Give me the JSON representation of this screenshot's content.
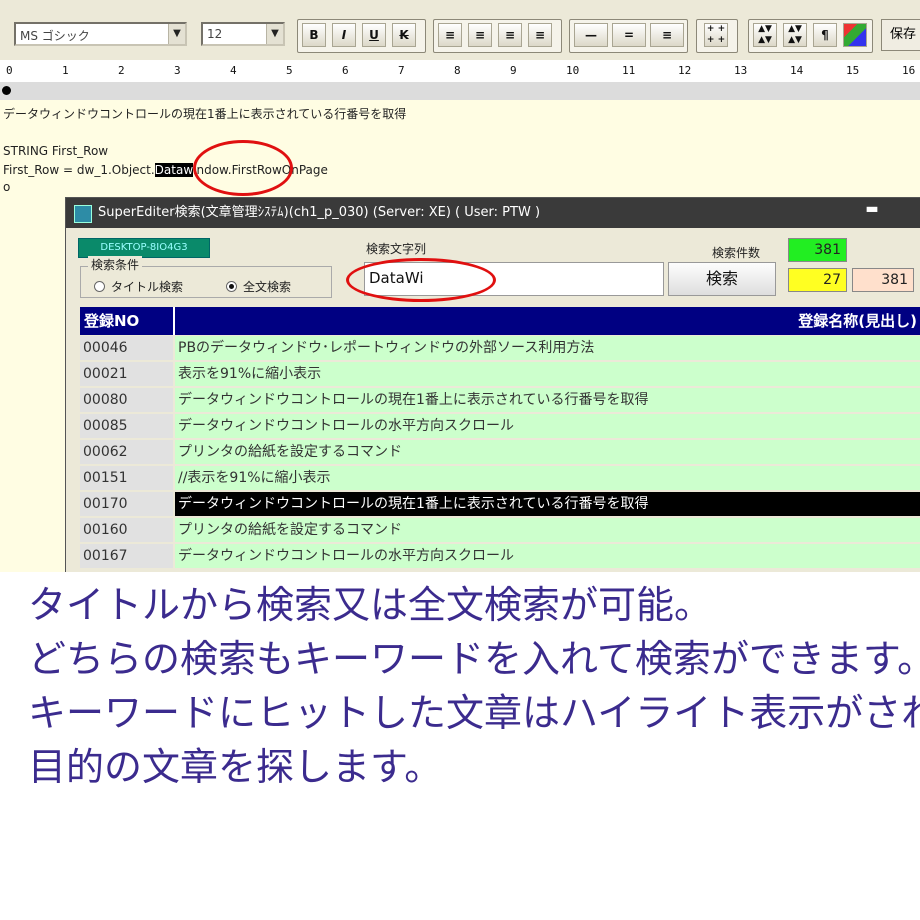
{
  "toolbar": {
    "font_value": "MS ゴシック",
    "size_value": "12",
    "bold": "B",
    "italic": "I",
    "underline": "U",
    "strike": "K",
    "pilcrow": "¶",
    "save_label": "保存"
  },
  "ruler": [
    "0",
    "1",
    "2",
    "3",
    "4",
    "5",
    "6",
    "7",
    "8",
    "9",
    "10",
    "11",
    "12",
    "13",
    "14",
    "15",
    "16"
  ],
  "editor": {
    "line1": "データウィンドウコントロールの現在1番上に表示されている行番号を取得",
    "line2": "STRING First_Row",
    "line3_pre": "First_Row = dw_1.Object.",
    "line3_hl": "Dataw",
    "line3_post": "indow.FirstRowOnPage",
    "line4": "o"
  },
  "dialog": {
    "title": "SuperEditer検索(文章管理ｼｽﾃﾑ)(ch1_p_030) (Server: XE) ( User: PTW )",
    "desktop_badge": "DESKTOP-8IO4G3",
    "search_label": "検索文字列",
    "search_value": "DataWi",
    "condition_legend": "検索条件",
    "radio_title": "タイトル検索",
    "radio_fulltext": "全文検索",
    "search_button": "検索",
    "count_label": "検索件数",
    "count_total": "381",
    "count_hit": "27",
    "count_all": "381",
    "colors": {
      "green": "#22ee22",
      "yellow": "#ffff22",
      "peach": "#ffe0cc"
    }
  },
  "grid": {
    "headers": [
      "登録NO",
      "登録名称(見出し)"
    ],
    "rows": [
      {
        "no": "00046",
        "title": "PBのデータウィンドウ･レポートウィンドウの外部ソース利用方法"
      },
      {
        "no": "00021",
        "title": "表示を91%に縮小表示"
      },
      {
        "no": "00080",
        "title": "データウィンドウコントロールの現在1番上に表示されている行番号を取得"
      },
      {
        "no": "00085",
        "title": "データウィンドウコントロールの水平方向スクロール"
      },
      {
        "no": "00062",
        "title": "プリンタの給紙を設定するコマンド"
      },
      {
        "no": "00151",
        "title": "//表示を91%に縮小表示"
      },
      {
        "no": "00170",
        "title": "データウィンドウコントロールの現在1番上に表示されている行番号を取得"
      },
      {
        "no": "00160",
        "title": "プリンタの給紙を設定するコマンド"
      },
      {
        "no": "00167",
        "title": "データウィンドウコントロールの水平方向スクロール"
      }
    ]
  },
  "caption": [
    "タイトルから検索又は全文検索が可能。",
    "どちらの検索もキーワードを入れて検索ができます。",
    "キーワードにヒットした文章はハイライト表示がされ",
    "目的の文章を探します。"
  ]
}
